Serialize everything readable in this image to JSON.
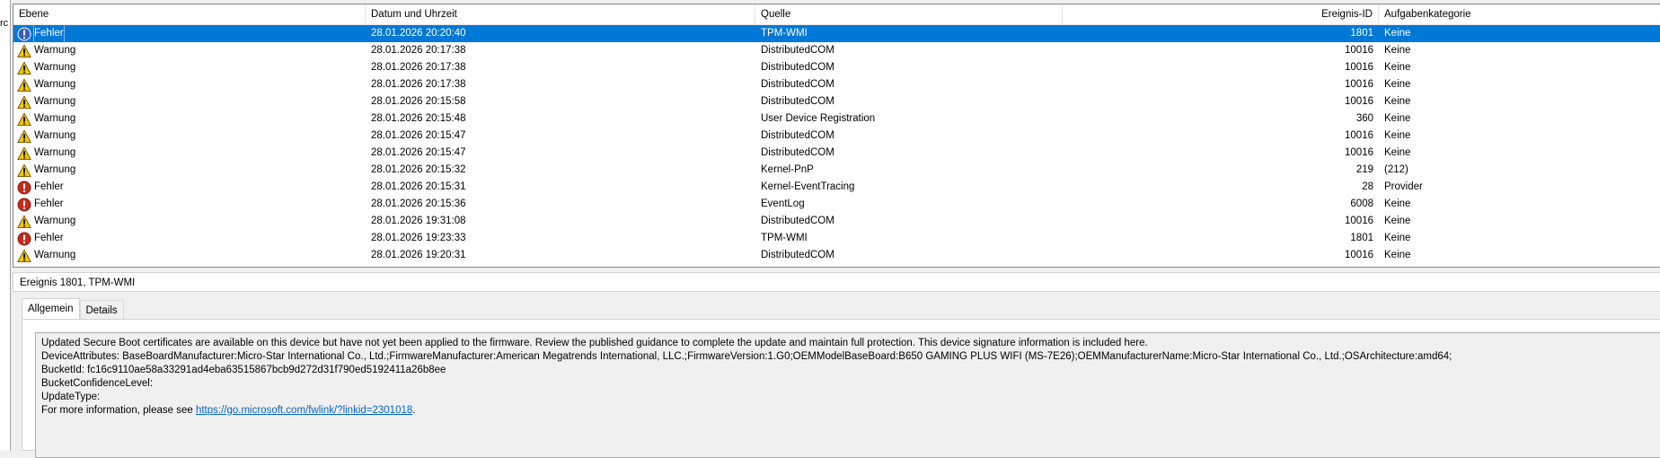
{
  "left_fragment": "rc",
  "columns": {
    "level": "Ebene",
    "date": "Datum und Uhrzeit",
    "source": "Quelle",
    "event_id": "Ereignis-ID",
    "category": "Aufgabenkategorie"
  },
  "events": [
    {
      "level": "Fehler",
      "icon": "error-icon",
      "date": "28.01.2026 20:20:40",
      "source": "TPM-WMI",
      "event_id": "1801",
      "category": "Keine",
      "selected": true
    },
    {
      "level": "Warnung",
      "icon": "warning-icon",
      "date": "28.01.2026 20:17:38",
      "source": "DistributedCOM",
      "event_id": "10016",
      "category": "Keine"
    },
    {
      "level": "Warnung",
      "icon": "warning-icon",
      "date": "28.01.2026 20:17:38",
      "source": "DistributedCOM",
      "event_id": "10016",
      "category": "Keine"
    },
    {
      "level": "Warnung",
      "icon": "warning-icon",
      "date": "28.01.2026 20:17:38",
      "source": "DistributedCOM",
      "event_id": "10016",
      "category": "Keine"
    },
    {
      "level": "Warnung",
      "icon": "warning-icon",
      "date": "28.01.2026 20:15:58",
      "source": "DistributedCOM",
      "event_id": "10016",
      "category": "Keine"
    },
    {
      "level": "Warnung",
      "icon": "warning-icon",
      "date": "28.01.2026 20:15:48",
      "source": "User Device Registration",
      "event_id": "360",
      "category": "Keine"
    },
    {
      "level": "Warnung",
      "icon": "warning-icon",
      "date": "28.01.2026 20:15:47",
      "source": "DistributedCOM",
      "event_id": "10016",
      "category": "Keine"
    },
    {
      "level": "Warnung",
      "icon": "warning-icon",
      "date": "28.01.2026 20:15:47",
      "source": "DistributedCOM",
      "event_id": "10016",
      "category": "Keine"
    },
    {
      "level": "Warnung",
      "icon": "warning-icon",
      "date": "28.01.2026 20:15:32",
      "source": "Kernel-PnP",
      "event_id": "219",
      "category": "(212)"
    },
    {
      "level": "Fehler",
      "icon": "error-icon",
      "date": "28.01.2026 20:15:31",
      "source": "Kernel-EventTracing",
      "event_id": "28",
      "category": "Provider"
    },
    {
      "level": "Fehler",
      "icon": "error-icon",
      "date": "28.01.2026 20:15:36",
      "source": "EventLog",
      "event_id": "6008",
      "category": "Keine"
    },
    {
      "level": "Warnung",
      "icon": "warning-icon",
      "date": "28.01.2026 19:31:08",
      "source": "DistributedCOM",
      "event_id": "10016",
      "category": "Keine"
    },
    {
      "level": "Fehler",
      "icon": "error-icon",
      "date": "28.01.2026 19:23:33",
      "source": "TPM-WMI",
      "event_id": "1801",
      "category": "Keine"
    },
    {
      "level": "Warnung",
      "icon": "warning-icon",
      "date": "28.01.2026 19:20:31",
      "source": "DistributedCOM",
      "event_id": "10016",
      "category": "Keine"
    }
  ],
  "detail": {
    "title": "Ereignis 1801, TPM-WMI",
    "tabs": [
      "Allgemein",
      "Details"
    ],
    "active_tab": "Allgemein",
    "message": {
      "line1": "Updated Secure Boot certificates are available on this device but have not yet been applied to the firmware. Review the published guidance to complete the update and maintain full protection. This device signature information is included here.",
      "line2": "DeviceAttributes: BaseBoardManufacturer:Micro-Star International Co., Ltd.;FirmwareManufacturer:American Megatrends International, LLC.;FirmwareVersion:1.G0;OEMModelBaseBoard:B650 GAMING PLUS WIFI (MS-7E26);OEMManufacturerName:Micro-Star International Co., Ltd.;OSArchitecture:amd64;",
      "line3": "BucketId: fc16c9110ae58a33291ad4eba63515867bcb9d272d31f790ed5192411a26b8ee",
      "line4": "BucketConfidenceLevel:",
      "line5": "UpdateType:",
      "line6_prefix": "For more information, please see ",
      "link": "https://go.microsoft.com/fwlink/?linkid=2301018",
      "line6_suffix": "."
    }
  },
  "colors": {
    "selection": "#0078d7",
    "error": "#c42b1c",
    "warning": "#f7c600",
    "link": "#0066cc"
  }
}
